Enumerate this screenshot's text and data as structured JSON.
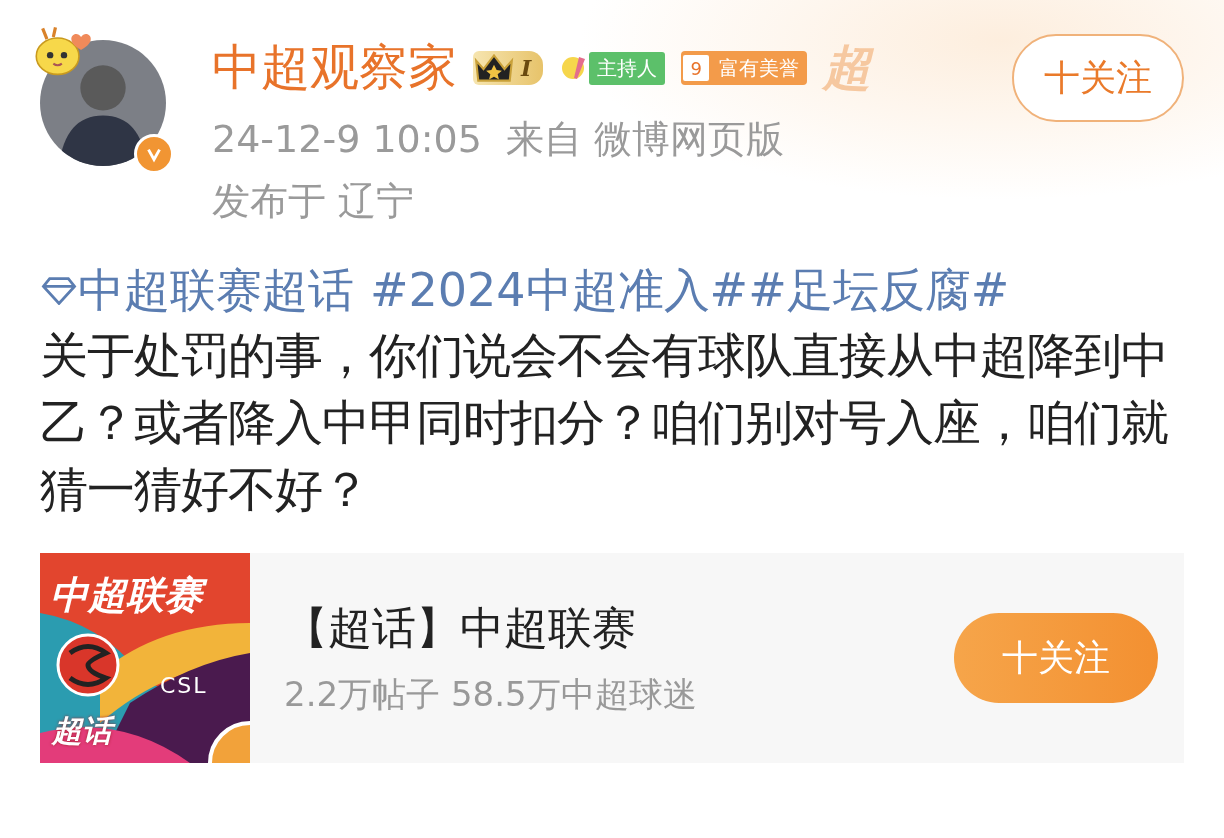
{
  "author": {
    "name": "中超观察家",
    "verified": true,
    "level_badge": "I",
    "host_badge": "主持人",
    "honor_badge": {
      "number": "9",
      "label": "富有美誉"
    },
    "decoration": "超"
  },
  "follow_button": {
    "label": "十关注"
  },
  "meta": {
    "time": "24-12-9 10:05",
    "source": "来自 微博网页版",
    "location": "发布于 辽宁"
  },
  "post": {
    "topic_link": "中超联赛超话",
    "hashtags": [
      "#2024中超准入#",
      "#足坛反腐#"
    ],
    "text": "关于处罚的事，你们说会不会有球队直接从中超降到中乙？或者降入中甲同时扣分？咱们别对号入座，咱们就猜一猜好不好？"
  },
  "topic_card": {
    "thumbnail": {
      "title": "中超联赛",
      "subtitle": "CSL",
      "tag": "超话"
    },
    "title": "【超话】中超联赛",
    "stats": "2.2万帖子 58.5万中超球迷",
    "follow_label": "十关注"
  }
}
